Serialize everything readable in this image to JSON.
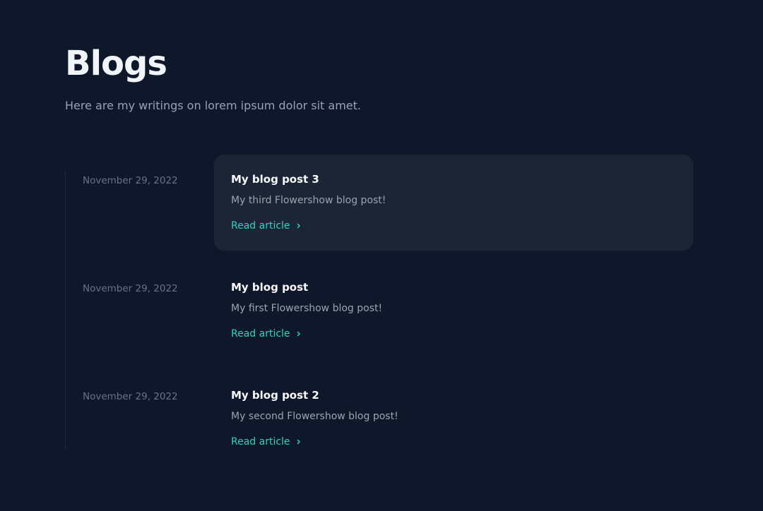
{
  "header": {
    "title": "Blogs",
    "subtitle": "Here are my writings on lorem ipsum dolor sit amet."
  },
  "posts": [
    {
      "date": "November 29, 2022",
      "title": "My blog post 3",
      "excerpt": "My third Flowershow blog post!",
      "link_label": "Read article",
      "highlighted": true
    },
    {
      "date": "November 29, 2022",
      "title": "My blog post",
      "excerpt": "My first Flowershow blog post!",
      "link_label": "Read article",
      "highlighted": false
    },
    {
      "date": "November 29, 2022",
      "title": "My blog post 2",
      "excerpt": "My second Flowershow blog post!",
      "link_label": "Read article",
      "highlighted": false
    }
  ],
  "colors": {
    "background": "#0f172a",
    "card_highlight": "#1b2536",
    "accent": "#2dd4bf",
    "title": "#f8fafc",
    "muted": "#94a3b8",
    "date": "#64748b"
  },
  "icons": {
    "link_icon": "chevron-right-icon"
  }
}
